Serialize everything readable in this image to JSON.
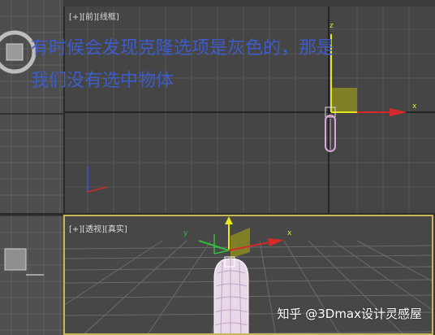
{
  "viewports": {
    "front": {
      "label": "[+][前][线框]"
    },
    "perspective": {
      "label": "[+][透视][真实]"
    }
  },
  "axes": {
    "x": "x",
    "y": "y",
    "z": "z"
  },
  "overlay": {
    "line1": "有时候会发现克隆选项是灰色的，那是",
    "line2": "我们没有选中物体"
  },
  "watermark": "知乎 @3Dmax设计灵感屋",
  "colors": {
    "overlay_text": "#3d5cc9",
    "active_border": "#c9b85a",
    "axis_x": "#d42a2a",
    "axis_y": "#2fbf3a",
    "axis_z": "#e6e61a",
    "object": "#d9a6d9"
  }
}
